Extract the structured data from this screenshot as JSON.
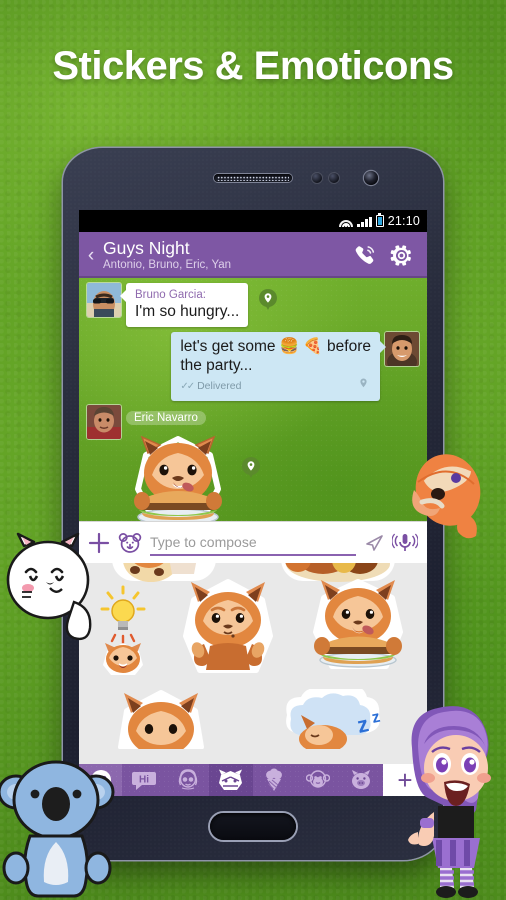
{
  "promo": {
    "headline": "Stickers & Emoticons",
    "background_color": "#5c9e25"
  },
  "theme": {
    "purple": "#7e57a4",
    "tabbar_purple": "#7a54a0",
    "tab_active_purple": "#6a4691",
    "chat_green": "#6fae2c",
    "incoming_bubble": "#ffffff",
    "outgoing_bubble": "#cde7f4",
    "sticker_panel": "#e9e9e9"
  },
  "status_bar": {
    "time": "21:10",
    "icons": [
      "wifi-icon",
      "signal-icon",
      "battery-icon"
    ]
  },
  "header": {
    "back_icon": "‹",
    "title": "Guys Night",
    "participants": "Antonio, Bruno, Eric, Yan",
    "call_icon": "phone-call-icon",
    "settings_icon": "gear-icon"
  },
  "chat": {
    "messages": [
      {
        "id": "msg-bruno",
        "direction": "in",
        "sender": "Bruno Garcia:",
        "text": "I'm so hungry...",
        "avatar": "avatar-bruno",
        "pin": "location-pin-icon"
      },
      {
        "id": "msg-outgoing",
        "direction": "out",
        "sender": "",
        "text": "let's get some 🍔 🍕 before the party...",
        "text_part1": "let's get some",
        "emoji1": "🍔",
        "emoji2": "🍕",
        "text_part2": "before",
        "text_line2": "the party...",
        "check_marks": "✓✓",
        "status": "Delivered",
        "avatar": "avatar-self",
        "pin": "location-pin-icon"
      },
      {
        "id": "msg-eric-sticker",
        "direction": "in",
        "sender": "Eric Navarro",
        "sticker": "red-panda-burger-sticker",
        "avatar": "avatar-eric",
        "pin": "location-pin-icon"
      }
    ]
  },
  "compose": {
    "add_icon": "plus-icon",
    "sticker_icon": "bear-face-icon",
    "placeholder": "Type to compose",
    "value": "",
    "send_icon": "send-arrow-icon",
    "mic_icon": "microphone-icon"
  },
  "sticker_panel": {
    "stickers": [
      {
        "name": "panda-muffin-sticker",
        "row": 0
      },
      {
        "name": "panda-lying-sticker",
        "row": 0
      },
      {
        "name": "panda-idea-sticker",
        "row": 1
      },
      {
        "name": "panda-thumbs-up-sticker",
        "row": 1
      },
      {
        "name": "panda-burger-sticker",
        "row": 1
      },
      {
        "name": "panda-peek-sticker",
        "row": 2
      },
      {
        "name": "panda-sleeping-sticker",
        "row": 2
      }
    ]
  },
  "sticker_tabs": {
    "items": [
      {
        "id": "tab-emoticons",
        "icon": "smiley-icon",
        "label": "",
        "state": "light"
      },
      {
        "id": "tab-hi",
        "icon": "hi-bubble-icon",
        "label": "Hi",
        "state": "normal"
      },
      {
        "id": "tab-girl",
        "icon": "girl-face-icon",
        "label": "",
        "state": "normal"
      },
      {
        "id": "tab-red-panda",
        "icon": "red-panda-icon",
        "label": "",
        "state": "active"
      },
      {
        "id": "tab-ice-cream",
        "icon": "ice-cream-icon",
        "label": "",
        "state": "normal"
      },
      {
        "id": "tab-monkey",
        "icon": "monkey-icon",
        "label": "",
        "state": "normal"
      },
      {
        "id": "tab-pig",
        "icon": "pig-icon",
        "label": "",
        "state": "normal"
      }
    ],
    "add_label": "+"
  },
  "mascots": [
    {
      "id": "cat-mascot",
      "name": "white-cat-mascot"
    },
    {
      "id": "koala-mascot",
      "name": "blue-koala-mascot"
    },
    {
      "id": "girl-mascot",
      "name": "purple-hair-girl-mascot"
    },
    {
      "id": "orange-mascot",
      "name": "orange-creature-mascot"
    }
  ]
}
